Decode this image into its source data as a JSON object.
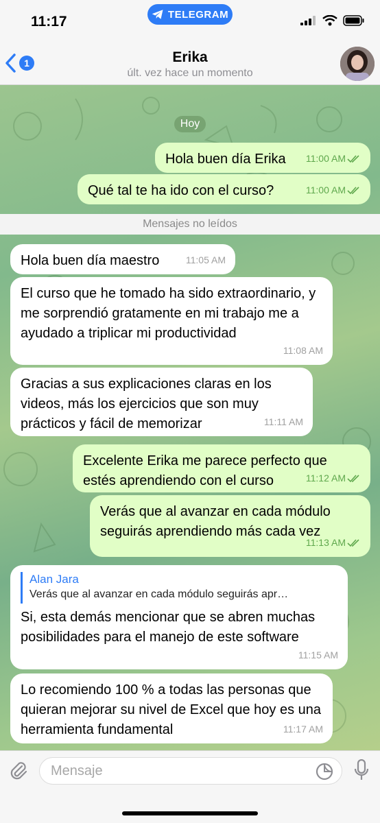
{
  "status_bar": {
    "time": "11:17",
    "app_pill": "TELEGRAM"
  },
  "header": {
    "back_badge": "1",
    "name": "Erika",
    "status": "últ. vez hace un momento"
  },
  "chat": {
    "date_label": "Hoy",
    "unread_label": "Mensajes no leídos",
    "messages": [
      {
        "dir": "out",
        "text": "Hola buen día Erika",
        "time": "11:00 AM"
      },
      {
        "dir": "out",
        "text": "Qué tal te ha ido con el curso?",
        "time": "11:00 AM"
      },
      {
        "dir": "in",
        "text": "Hola buen día maestro",
        "time": "11:05 AM"
      },
      {
        "dir": "in",
        "text": "El curso que he tomado ha sido extraordinario, y me sorprendió gratamente en mi trabajo me a ayudado a triplicar mi productividad",
        "time": "11:08 AM"
      },
      {
        "dir": "in",
        "text": "Gracias a sus explicaciones claras en los videos, más los ejercicios que son muy prácticos y fácil de memorizar",
        "time": "11:11 AM"
      },
      {
        "dir": "out",
        "text": "Excelente Erika me parece perfecto que estés aprendiendo con el curso",
        "time": "11:12 AM"
      },
      {
        "dir": "out",
        "text": "Verás que al avanzar en cada módulo seguirás aprendiendo más cada vez",
        "time": "11:13 AM"
      },
      {
        "dir": "in",
        "reply_name": "Alan Jara",
        "reply_text": "Verás que al avanzar en cada módulo seguirás apr…",
        "text": "Si, esta demás mencionar que se abren muchas posibilidades para el manejo de este software",
        "time": "11:15 AM"
      },
      {
        "dir": "in",
        "text": "Lo recomiendo 100 % a todas las personas que quieran mejorar su nivel de Excel que hoy es una herramienta fundamental",
        "time": "11:17 AM"
      }
    ]
  },
  "input": {
    "placeholder": "Mensaje"
  },
  "colors": {
    "accent": "#2e7cf6",
    "outgoing": "#e1fec6",
    "incoming": "#ffffff",
    "check": "#5fa84d"
  }
}
